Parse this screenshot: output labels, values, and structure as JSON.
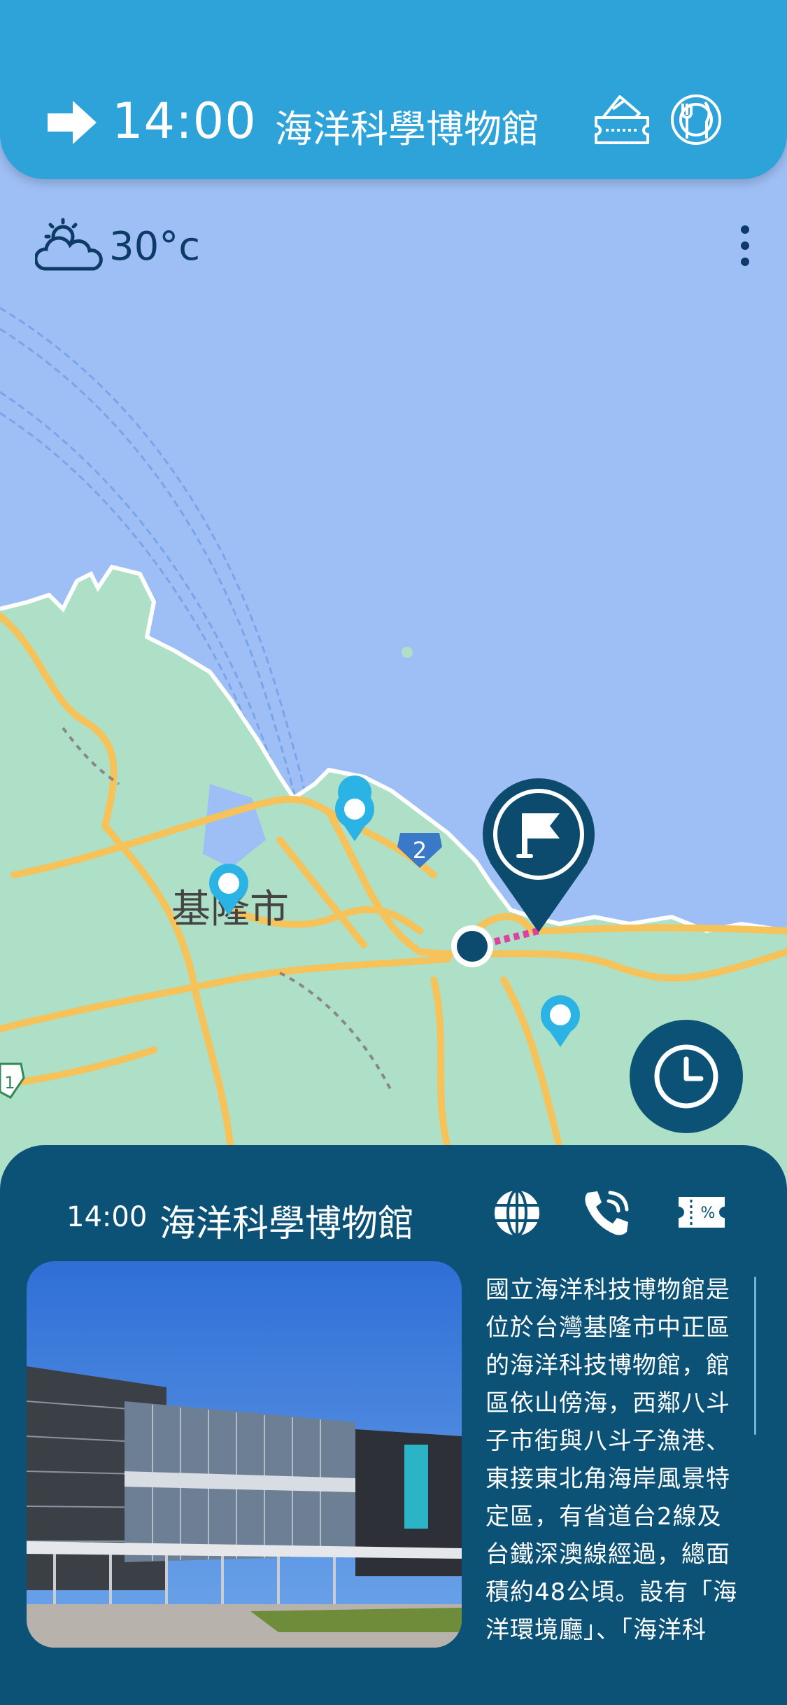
{
  "header": {
    "time": "14:00",
    "title": "海洋科學博物館",
    "icons": [
      "arrow-right-icon",
      "ticket-icon",
      "restaurant-icon"
    ]
  },
  "weather": {
    "icon": "partly-cloudy-icon",
    "temperature": "30°c"
  },
  "map": {
    "city_label": "基隆市",
    "route_badge": "2",
    "edge_badge": "1",
    "colors": {
      "sea": "#9ebff5",
      "land": "#aedfc7",
      "road": "#f6c35b",
      "route": "#e040a0",
      "pin": "#2bb3e6"
    }
  },
  "card": {
    "time": "14:00",
    "title": "海洋科學博物館",
    "icons": [
      "globe-icon",
      "phone-icon",
      "coupon-icon"
    ],
    "description": "國立海洋科技博物館是位於台灣基隆市中正區的海洋科技博物館，館區依山傍海，西鄰八斗子市街與八斗子漁港、東接東北角海岸風景特定區，有省道台2線及台鐵深澳線經過，總面積約48公頃。設有「海洋環境廳」、「海洋科"
  },
  "colors": {
    "header": "#2ea3d9",
    "card": "#0c5277",
    "text_dark": "#0d3b66"
  }
}
